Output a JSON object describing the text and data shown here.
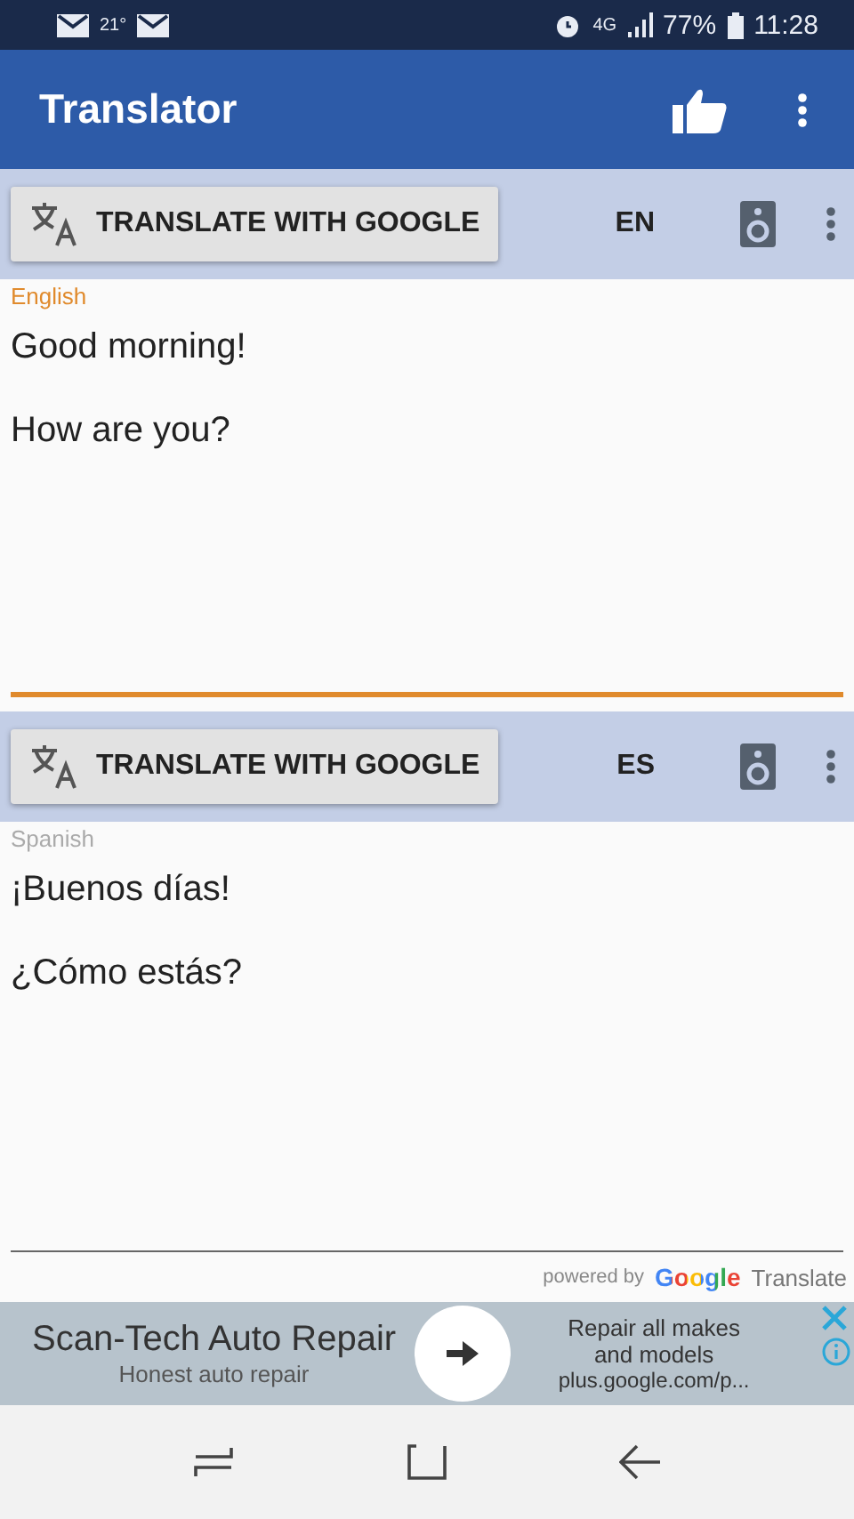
{
  "status_bar": {
    "temperature": "21°",
    "network": "4G",
    "battery": "77%",
    "time": "11:28"
  },
  "app_bar": {
    "title": "Translator"
  },
  "panels": [
    {
      "button": "TRANSLATE WITH GOOGLE",
      "lang_code": "EN",
      "language": "English",
      "focused": true,
      "lines": [
        "Good morning!",
        "How are you?"
      ]
    },
    {
      "button": "TRANSLATE WITH GOOGLE",
      "lang_code": "ES",
      "language": "Spanish",
      "focused": false,
      "lines": [
        "¡Buenos días!",
        "¿Cómo estás?"
      ]
    }
  ],
  "attribution": {
    "prefix": "powered by",
    "brand": "Google",
    "product": "Translate"
  },
  "ad": {
    "title": "Scan-Tech Auto Repair",
    "subtitle": "Honest auto repair",
    "text": "Repair all makes and models",
    "url": "plus.google.com/p..."
  }
}
